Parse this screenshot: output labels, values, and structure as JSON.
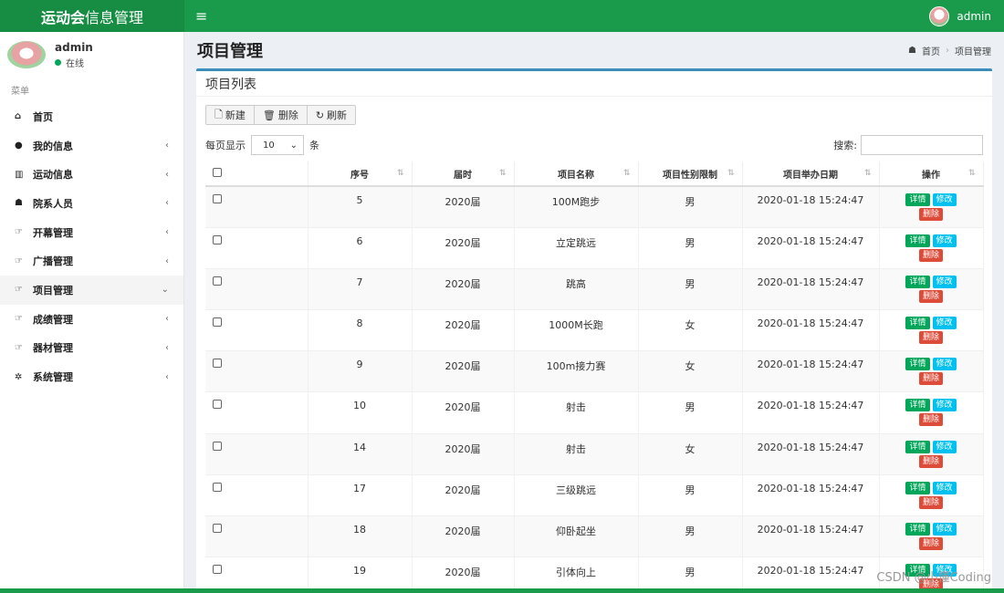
{
  "header": {
    "logo_bold": "运动会",
    "logo_rest": "信息管理",
    "menu_icon": "≡",
    "user": "admin"
  },
  "sidebar": {
    "user_name": "admin",
    "status": "在线",
    "menu_header": "菜单",
    "items": [
      {
        "label": "首页",
        "icon": "home-icon",
        "glyph": "⌂",
        "has_arrow": false
      },
      {
        "label": "我的信息",
        "icon": "user-icon",
        "glyph": "●",
        "has_arrow": true
      },
      {
        "label": "运动信息",
        "icon": "bar-chart-icon",
        "glyph": "▥",
        "has_arrow": true
      },
      {
        "label": "院系人员",
        "icon": "users-icon",
        "glyph": "☗",
        "has_arrow": true
      },
      {
        "label": "开幕管理",
        "icon": "thumbs-up-icon",
        "glyph": "☞",
        "has_arrow": true
      },
      {
        "label": "广播管理",
        "icon": "thumbs-up-icon",
        "glyph": "☞",
        "has_arrow": true
      },
      {
        "label": "项目管理",
        "icon": "thumbs-up-icon",
        "glyph": "☞",
        "has_arrow": true,
        "active": true
      },
      {
        "label": "成绩管理",
        "icon": "thumbs-up-icon",
        "glyph": "☞",
        "has_arrow": true
      },
      {
        "label": "器材管理",
        "icon": "thumbs-up-icon",
        "glyph": "☞",
        "has_arrow": true
      },
      {
        "label": "系统管理",
        "icon": "gear-icon",
        "glyph": "✲",
        "has_arrow": true
      }
    ]
  },
  "page": {
    "title": "项目管理",
    "breadcrumb": [
      "首页",
      "项目管理"
    ],
    "box_title": "项目列表",
    "toolbar": {
      "new": "新建",
      "delete": "删除",
      "refresh": "刷新"
    },
    "length_prefix": "每页显示",
    "length_value": "10",
    "length_suffix": "条",
    "search_label": "搜索:"
  },
  "table": {
    "columns": [
      "",
      "序号",
      "届时",
      "项目名称",
      "项目性别限制",
      "项目举办日期",
      "操作"
    ],
    "actions": {
      "detail": "详情",
      "edit": "修改",
      "delete": "删除"
    },
    "rows": [
      [
        "5",
        "2020届",
        "100M跑步",
        "男",
        "2020-01-18 15:24:47"
      ],
      [
        "6",
        "2020届",
        "立定跳远",
        "男",
        "2020-01-18 15:24:47"
      ],
      [
        "7",
        "2020届",
        "跳高",
        "男",
        "2020-01-18 15:24:47"
      ],
      [
        "8",
        "2020届",
        "1000M长跑",
        "女",
        "2020-01-18 15:24:47"
      ],
      [
        "9",
        "2020届",
        "100m接力赛",
        "女",
        "2020-01-18 15:24:47"
      ],
      [
        "10",
        "2020届",
        "射击",
        "男",
        "2020-01-18 15:24:47"
      ],
      [
        "14",
        "2020届",
        "射击",
        "女",
        "2020-01-18 15:24:47"
      ],
      [
        "17",
        "2020届",
        "三级跳远",
        "男",
        "2020-01-18 15:24:47"
      ],
      [
        "18",
        "2020届",
        "仰卧起坐",
        "男",
        "2020-01-18 15:24:47"
      ],
      [
        "19",
        "2020届",
        "引体向上",
        "男",
        "2020-01-18 15:24:47"
      ]
    ]
  },
  "watermark": "CSDN @小懂Coding"
}
